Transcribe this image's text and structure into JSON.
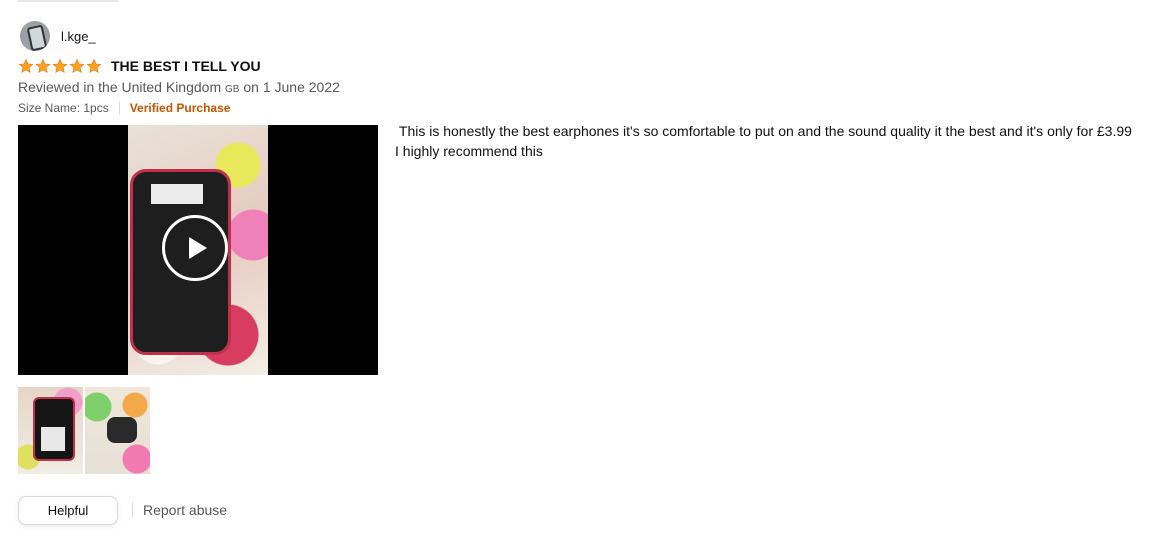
{
  "reviewer": {
    "name": "l.kge_"
  },
  "review": {
    "rating": 5,
    "rating_max": 5,
    "title": "THE BEST I TELL YOU",
    "meta_prefix": "Reviewed in the United Kingdom",
    "country_code": "GB",
    "meta_suffix": "on 1 June 2022",
    "size_name": "Size Name: 1pcs",
    "verified": "Verified Purchase",
    "body": " This is honestly the best earphones it's so comfortable to put on and the sound quality it the best and it's only for £3.99 I highly recommend this"
  },
  "actions": {
    "helpful": "Helpful",
    "report": "Report abuse"
  },
  "colors": {
    "star": "#ffa41c",
    "verified": "#c45500",
    "muted": "#565959"
  }
}
